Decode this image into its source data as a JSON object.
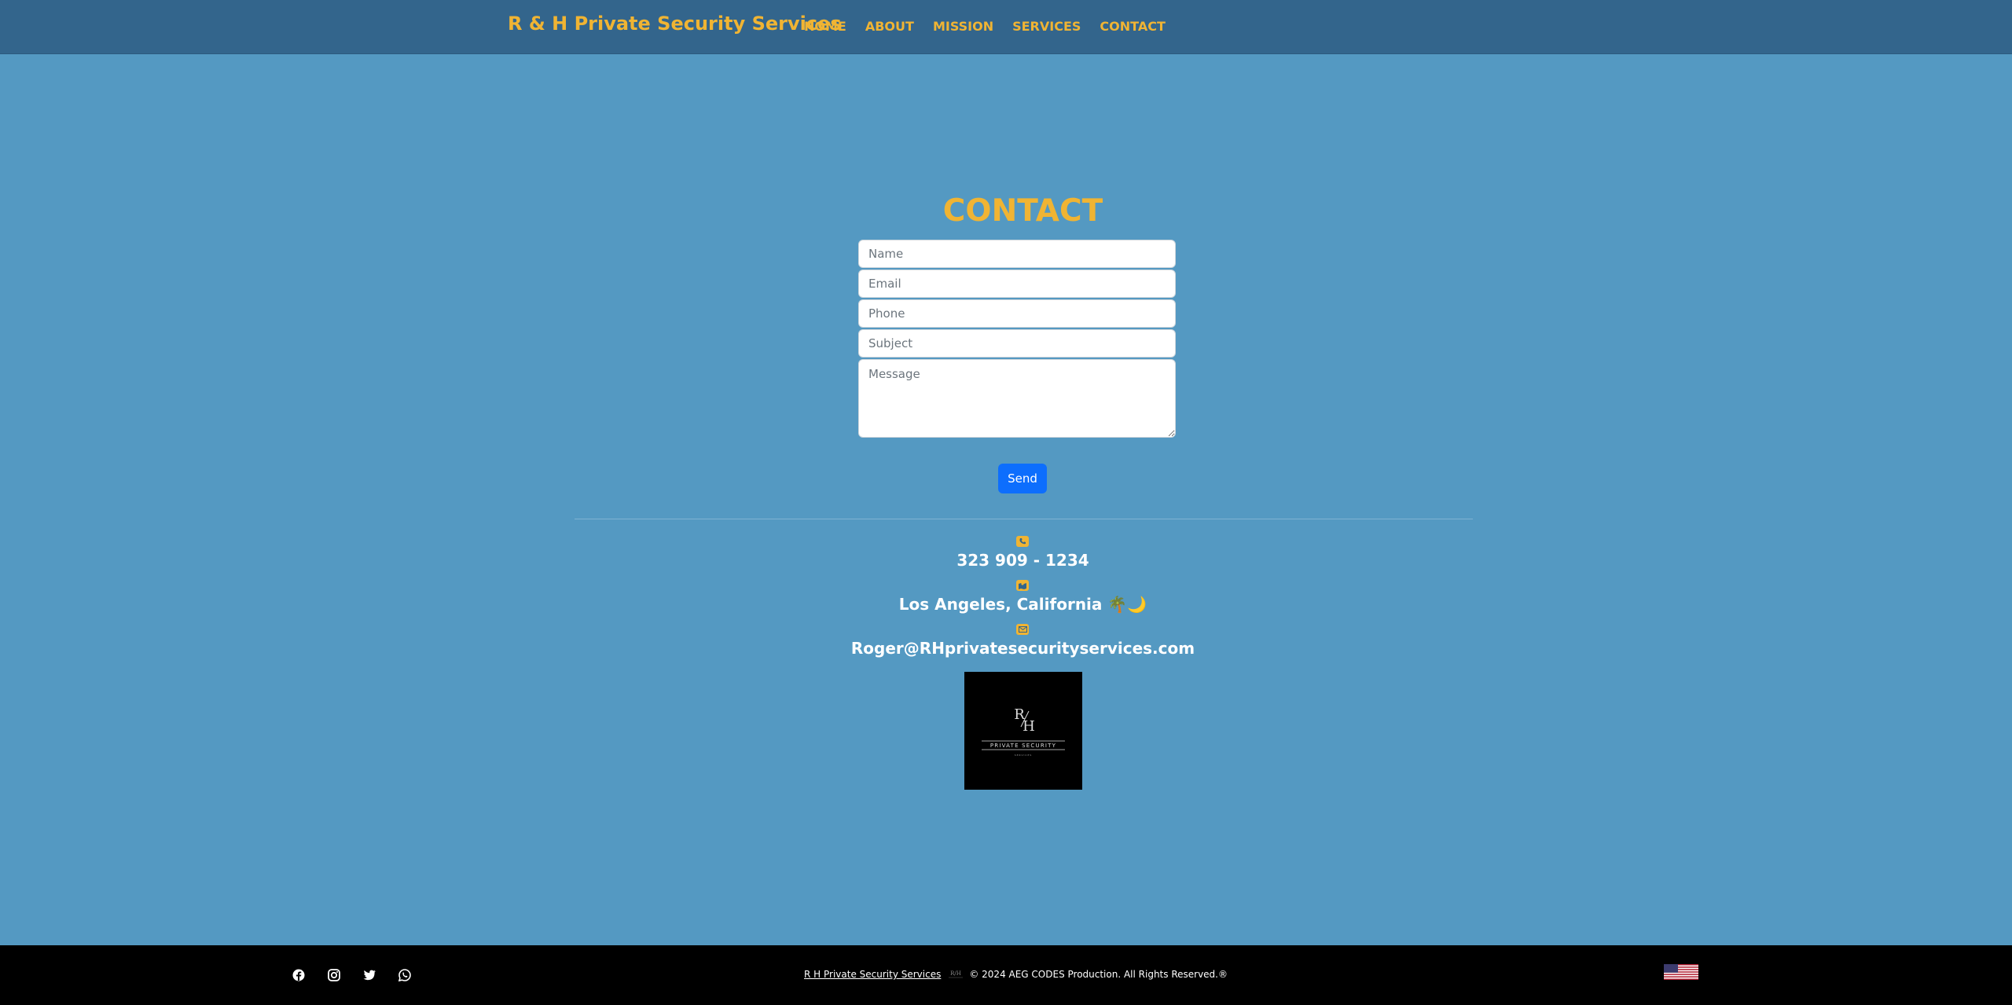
{
  "nav": {
    "brand": "R & H Private Security Services",
    "links": [
      "HOME",
      "ABOUT",
      "MISSION",
      "SERVICES",
      "CONTACT"
    ]
  },
  "contact": {
    "title": "CONTACT",
    "fields": {
      "name_placeholder": "Name",
      "email_placeholder": "Email",
      "phone_placeholder": "Phone",
      "subject_placeholder": "Subject",
      "message_placeholder": "Message"
    },
    "send_label": "Send"
  },
  "info": {
    "phone": "323 909 - 1234",
    "location": "Los Angeles, California 🌴🌙",
    "email": "Roger@RHprivatesecurityservices.com"
  },
  "logo": {
    "monogram": "R/H",
    "tagline": "PRIVATE SECURITY",
    "sub": "SERVICES"
  },
  "footer": {
    "company_link": "R H Private Security Services",
    "copyright": "© 2024 AEG CODES Production. All Rights Reserved.®",
    "social_icons": [
      "facebook-icon",
      "instagram-icon",
      "twitter-icon",
      "whatsapp-icon"
    ]
  },
  "colors": {
    "background": "#5499c2",
    "navbar": "#33658c",
    "accent": "#f0b433",
    "button": "#0d6efd",
    "footer": "#000000"
  }
}
